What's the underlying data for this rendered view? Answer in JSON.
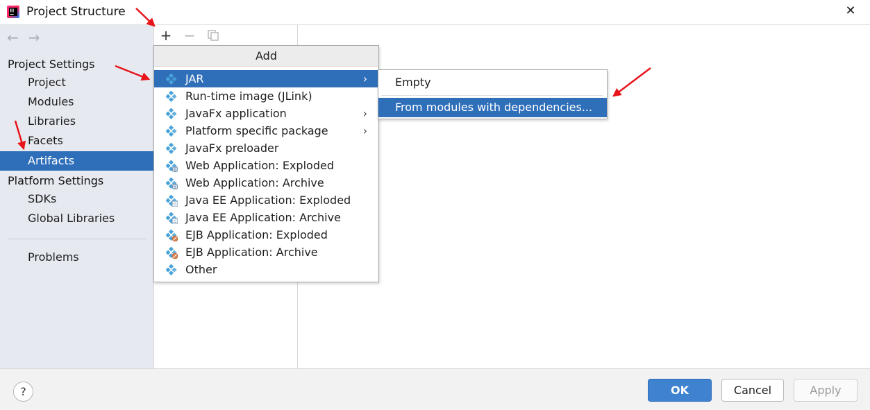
{
  "window": {
    "title": "Project Structure",
    "close_glyph": "✕"
  },
  "sidebar": {
    "back_glyph": "←",
    "forward_glyph": "→",
    "project_settings_title": "Project Settings",
    "project_items": [
      {
        "label": "Project"
      },
      {
        "label": "Modules"
      },
      {
        "label": "Libraries"
      },
      {
        "label": "Facets"
      },
      {
        "label": "Artifacts",
        "selected": true
      }
    ],
    "platform_settings_title": "Platform Settings",
    "platform_items": [
      {
        "label": "SDKs"
      },
      {
        "label": "Global Libraries"
      }
    ],
    "problems_label": "Problems"
  },
  "toolbar": {
    "add_glyph": "+",
    "remove_glyph": "−",
    "copy_icon": "copy-icon"
  },
  "add_menu": {
    "header": "Add",
    "items": [
      {
        "label": "JAR",
        "icon": "artifact-icon",
        "submenu": true,
        "selected": true
      },
      {
        "label": "Run-time image (JLink)",
        "icon": "artifact-icon"
      },
      {
        "label": "JavaFx application",
        "icon": "artifact-icon",
        "submenu": true
      },
      {
        "label": "Platform specific package",
        "icon": "artifact-icon",
        "submenu": true
      },
      {
        "label": "JavaFx preloader",
        "icon": "artifact-icon"
      },
      {
        "label": "Web Application: Exploded",
        "icon": "web-artifact-icon"
      },
      {
        "label": "Web Application: Archive",
        "icon": "web-artifact-icon"
      },
      {
        "label": "Java EE Application: Exploded",
        "icon": "javaee-artifact-icon"
      },
      {
        "label": "Java EE Application: Archive",
        "icon": "javaee-artifact-icon"
      },
      {
        "label": "EJB Application: Exploded",
        "icon": "ejb-artifact-icon"
      },
      {
        "label": "EJB Application: Archive",
        "icon": "ejb-artifact-icon"
      },
      {
        "label": "Other",
        "icon": "artifact-icon"
      }
    ],
    "chevron_glyph": "›"
  },
  "jar_submenu": {
    "items": [
      {
        "label": "Empty"
      },
      {
        "label": "From modules with dependencies...",
        "selected": true
      }
    ]
  },
  "footer": {
    "help_glyph": "?",
    "ok_label": "OK",
    "cancel_label": "Cancel",
    "apply_label": "Apply"
  },
  "colors": {
    "selection": "#2f6fba",
    "sidebar_bg": "#e6eaf0",
    "annotation_arrow": "#e8141b",
    "artifact_icon": "#4aa3d8"
  }
}
